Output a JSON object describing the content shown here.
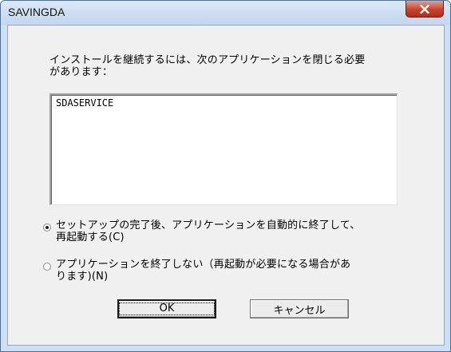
{
  "window": {
    "title": "SAVINGDA",
    "close_glyph": "x"
  },
  "message": {
    "line1": "インストールを継続するには、次のアプリケーションを閉じる必要",
    "line2": "があります："
  },
  "app_list": {
    "items": [
      "SDASERVICE"
    ]
  },
  "options": [
    {
      "line1": "セットアップの完了後、アプリケーションを自動的に終了して、",
      "line2": "再起動する(C)",
      "checked": true
    },
    {
      "line1": "アプリケーションを終了しない（再起動が必要になる場合があ",
      "line2": "ります)(N)",
      "checked": false
    }
  ],
  "buttons": {
    "ok": "OK",
    "cancel": "キャンセル"
  }
}
